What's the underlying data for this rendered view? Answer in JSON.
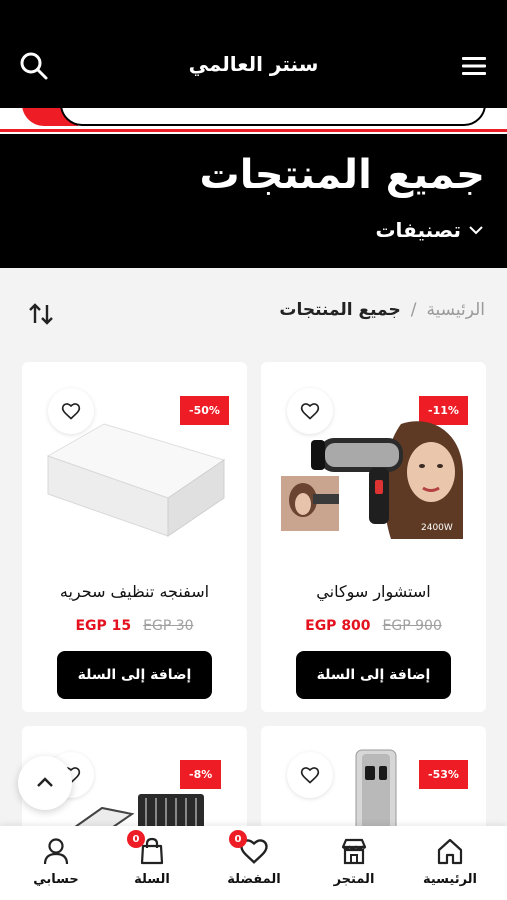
{
  "header": {
    "title": "سنتر العالمي",
    "search_icon": "search-icon",
    "menu_icon": "hamburger-menu-icon"
  },
  "hero": {
    "title": "جميع المنتجات",
    "categories_label": "تصنيفات"
  },
  "breadcrumb": {
    "home": "الرئيسية",
    "separator": "/",
    "current": "جميع المنتجات"
  },
  "products": [
    {
      "name": "استشوار سوكاني",
      "price": "EGP 800",
      "old_price": "EGP 900",
      "discount": "-11%",
      "add_label": "إضافة إلى السلة",
      "image": "hair-dryer"
    },
    {
      "name": "اسفنجه تنظيف سحريه",
      "price": "EGP 15",
      "old_price": "EGP 30",
      "discount": "-50%",
      "add_label": "إضافة إلى السلة",
      "image": "cleaning-sponge"
    },
    {
      "discount": "-53%",
      "image": "oil-sprayer"
    },
    {
      "discount": "-8%",
      "image": "grill-press"
    }
  ],
  "bottom_nav": {
    "items": [
      {
        "label": "الرئيسية",
        "icon": "home-icon"
      },
      {
        "label": "المتجر",
        "icon": "store-icon"
      },
      {
        "label": "المفضلة",
        "icon": "heart-icon",
        "count": "0"
      },
      {
        "label": "السلة",
        "icon": "shopping-bag-icon",
        "count": "0"
      },
      {
        "label": "حسابي",
        "icon": "user-icon"
      }
    ]
  },
  "colors": {
    "accent": "#ee1c25",
    "header_bg": "#000000",
    "price": "#e3121e"
  }
}
